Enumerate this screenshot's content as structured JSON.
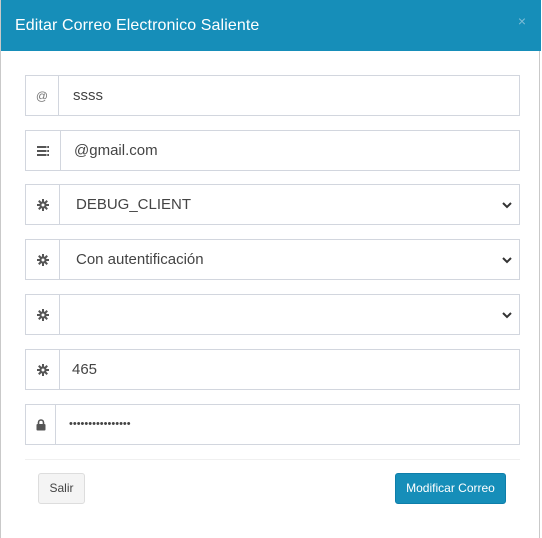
{
  "header": {
    "title": "Editar Correo Electronico Saliente",
    "close_symbol": "×"
  },
  "form": {
    "email_user": {
      "icon": "at-icon",
      "addon_text": "@",
      "value": "ssss"
    },
    "email_domain": {
      "icon": "server-icon",
      "value": "@gmail.com"
    },
    "debug_select": {
      "icon": "gear-icon",
      "selected": "DEBUG_CLIENT"
    },
    "auth_select": {
      "icon": "gear-icon",
      "selected": "Con autentificación"
    },
    "security_select": {
      "icon": "gear-icon",
      "selected": ""
    },
    "port": {
      "icon": "gear-icon",
      "value": "465"
    },
    "password": {
      "icon": "lock-icon",
      "masked_value": "••••••••••••••••"
    }
  },
  "footer": {
    "cancel_label": "Salir",
    "submit_label": "Modificar Correo"
  },
  "colors": {
    "header_bg": "#168eb9",
    "primary_button": "#168eb9",
    "input_border": "#d2d6de"
  }
}
